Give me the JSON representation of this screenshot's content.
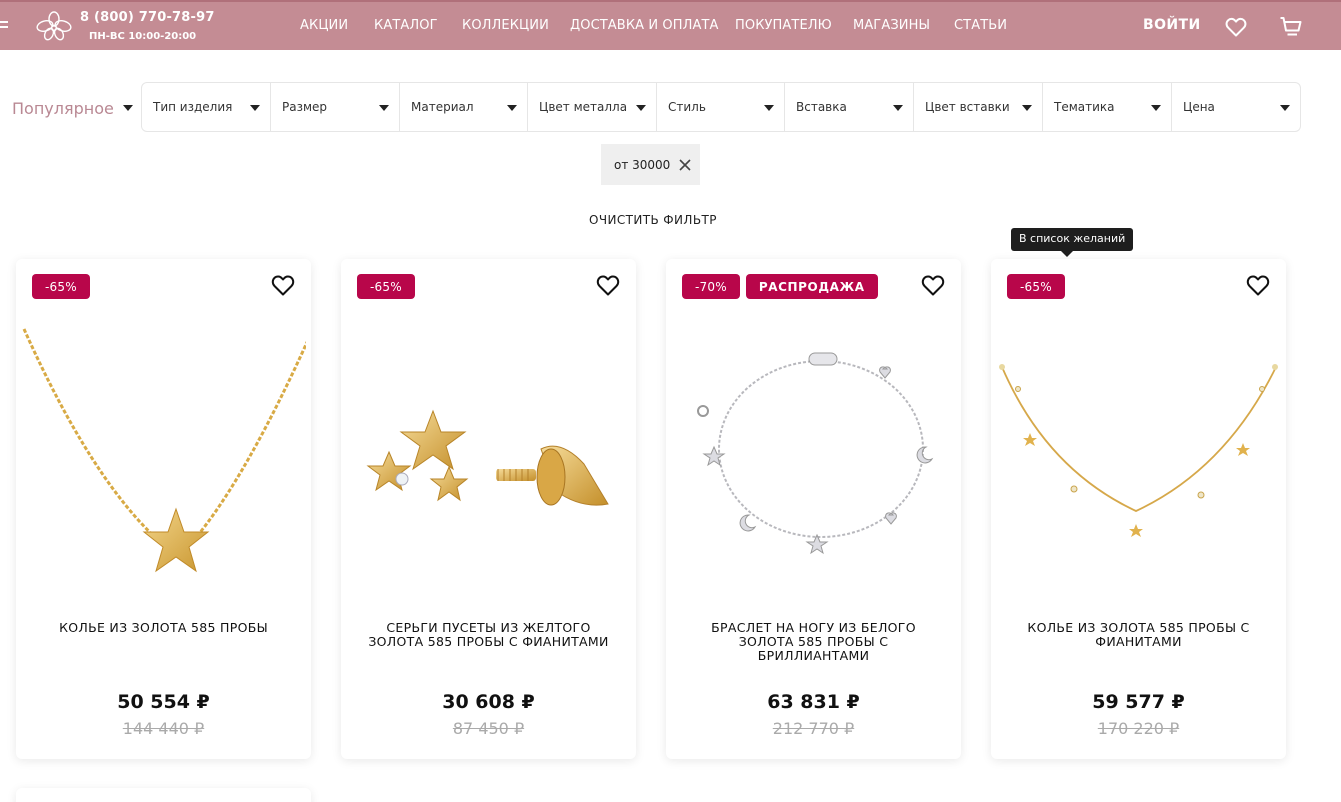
{
  "header": {
    "phone": "8 (800) 770-78-97",
    "hours": "ПН-ВС 10:00-20:00",
    "nav": [
      "АКЦИИ",
      "КАТАЛОГ",
      "КОЛЛЕКЦИИ",
      "ДОСТАВКА И ОПЛАТА",
      "ПОКУПАТЕЛЮ",
      "МАГАЗИНЫ",
      "СТАТЬИ"
    ],
    "login": "ВОЙТИ",
    "icons": [
      "menu-icon",
      "orchid-logo-icon",
      "heart-icon",
      "cart-icon"
    ],
    "bg_color": "#c48c94"
  },
  "filters": {
    "sort": "Популярное",
    "items": [
      "Тип изделия",
      "Размер",
      "Материал",
      "Цвет металла",
      "Стиль",
      "Вставка",
      "Цвет вставки",
      "Тематика",
      "Цена"
    ],
    "active_chip": "от 30000",
    "clear_label": "ОЧИСТИТЬ ФИЛЬТР"
  },
  "tooltip": "В список желаний",
  "accent_color": "#b8064a",
  "products": [
    {
      "badges": [
        "-65%"
      ],
      "title": "КОЛЬЕ ИЗ ЗОЛОТА 585 ПРОБЫ",
      "price": "50 554 ₽",
      "old_price": "144 440 ₽",
      "image": "gold-star-necklace"
    },
    {
      "badges": [
        "-65%"
      ],
      "title": "СЕРЬГИ ПУСЕТЫ ИЗ ЖЕЛТОГО ЗОЛОТА 585 ПРОБЫ С ФИАНИТАМИ",
      "price": "30 608 ₽",
      "old_price": "87 450 ₽",
      "image": "gold-star-earrings"
    },
    {
      "badges": [
        "-70%",
        "РАСПРОДАЖА"
      ],
      "title": "БРАСЛЕТ НА НОГУ ИЗ БЕЛОГО ЗОЛОТА 585 ПРОБЫ С БРИЛЛИАНТАМИ",
      "price": "63 831 ₽",
      "old_price": "212 770 ₽",
      "image": "white-gold-anklet"
    },
    {
      "badges": [
        "-65%"
      ],
      "title": "КОЛЬЕ ИЗ ЗОЛОТА 585 ПРОБЫ С ФИАНИТАМИ",
      "price": "59 577 ₽",
      "old_price": "170 220 ₽",
      "image": "gold-charm-necklace"
    }
  ]
}
